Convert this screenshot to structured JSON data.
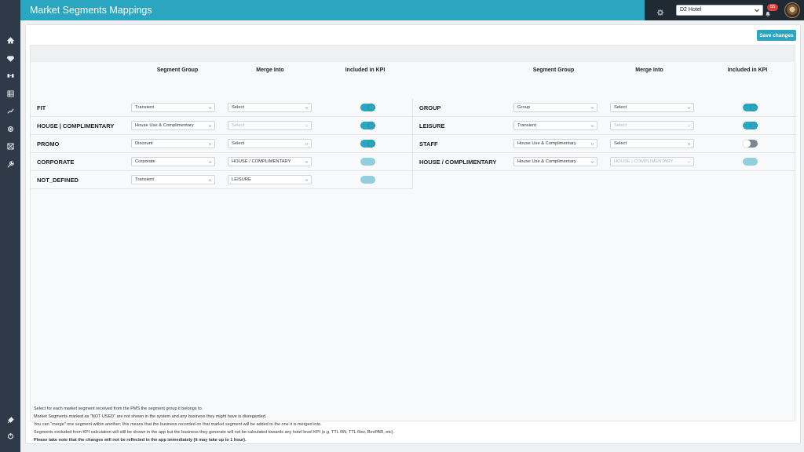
{
  "header": {
    "title": "Market Segments Mappings",
    "hotel_select": "D2 Hotel",
    "notification_count": "55"
  },
  "toolbar": {
    "save_label": "Save changes"
  },
  "columns": {
    "segment_group": "Segment Group",
    "merge_into": "Merge Into",
    "included_kpi": "Included in KPI"
  },
  "left_rows": [
    {
      "name": "FIT",
      "group": "Transient",
      "merge": "Select",
      "merge_disabled": false,
      "kpi": "on"
    },
    {
      "name": "HOUSE | COMPLIMENTARY",
      "group": "House Use & Complimentary",
      "merge": "Select",
      "merge_disabled": true,
      "kpi": "on"
    },
    {
      "name": "PROMO",
      "group": "Discount",
      "merge": "Select",
      "merge_disabled": false,
      "kpi": "on"
    },
    {
      "name": "CORPORATE",
      "group": "Corporate",
      "merge": "HOUSE / COMPLIMENTARY",
      "merge_disabled": false,
      "kpi": "disabled"
    },
    {
      "name": "NOT_DEFINED",
      "group": "Transient",
      "merge": "LEISURE",
      "merge_disabled": false,
      "kpi": "disabled"
    }
  ],
  "right_rows": [
    {
      "name": "GROUP",
      "group": "Group",
      "merge": "Select",
      "merge_disabled": false,
      "kpi": "on"
    },
    {
      "name": "LEISURE",
      "group": "Transient",
      "merge": "Select",
      "merge_disabled": true,
      "kpi": "on"
    },
    {
      "name": "STAFF",
      "group": "House Use & Complimentary",
      "merge": "Select",
      "merge_disabled": false,
      "kpi": "off"
    },
    {
      "name": "HOUSE / COMPLIMENTARY",
      "group": "House Use & Complimentary",
      "merge": "HOUSE | COMPLIMENTARY",
      "merge_disabled": true,
      "kpi": "disabled"
    }
  ],
  "notes": {
    "line1": "Select for each market segment received from the PMS the segment group it belongs to.",
    "line2": "Market Segments marked as \"NOT USED\" are not shown in the system and any business they might have is disregarded.",
    "line3": "You can \"merge\" one segment within another; this means that the business recorded on that market segment will be added to the one it is merged into.",
    "line4": "Segments excluded from KPI calculation will still be shown in the app but the business they generate will not be calculated towards any hotel level KPI (e.g. TTL RN, TTL Rev, RevPAR, etc).",
    "line5": "Please take note that the changes will not be reflected in the app immediately (it may take up to 1 hour)."
  },
  "colors": {
    "accent": "#2aa6c1",
    "sidebar": "#2e3a47",
    "header_dark": "#1f2a33",
    "badge": "#e0403c"
  },
  "icons": [
    "home-icon",
    "diamond-icon",
    "tag-icon",
    "grid-icon",
    "chart-line-icon",
    "settings-icon",
    "image-icon",
    "wrench-icon",
    "plug-icon",
    "power-icon",
    "gear-icon",
    "bell-icon",
    "chevron-down-icon"
  ]
}
